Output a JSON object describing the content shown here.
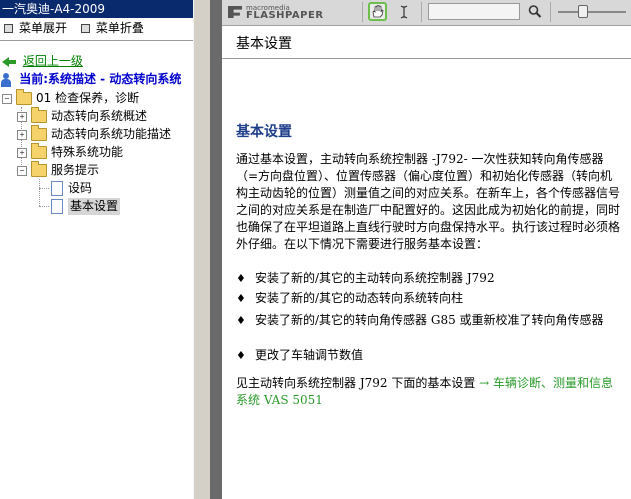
{
  "left_panel": {
    "title": "一汽奥迪-A4-2009",
    "menu_expand": "菜单展开",
    "menu_collapse": "菜单折叠",
    "back_link": "返回上一级",
    "current": "当前:系统描述 - 动态转向系统",
    "tree": [
      {
        "label": "01 检查保养，诊断",
        "expander": "−",
        "icon": "folder-open-icon"
      },
      {
        "label": "动态转向系统概述",
        "expander": "+",
        "icon": "folder-icon"
      },
      {
        "label": "动态转向系统功能描述",
        "expander": "+",
        "icon": "folder-icon"
      },
      {
        "label": "特殊系统功能",
        "expander": "+",
        "icon": "folder-icon"
      },
      {
        "label": "服务提示",
        "expander": "−",
        "icon": "folder-open-icon"
      },
      {
        "label": "设码",
        "icon": "document-icon"
      },
      {
        "label": "基本设置",
        "icon": "document-icon",
        "selected": true
      }
    ]
  },
  "toolbar": {
    "logo_top": "macromedia",
    "logo_bottom": "FLASHPAPER",
    "search_value": "",
    "zoom_level": 0.35
  },
  "document": {
    "header_title": "基本设置",
    "content_title": "基本设置",
    "intro": "通过基本设置，主动转向系统控制器 -J792- 一次性获知转向角传感器（=方向盘位置）、位置传感器（偏心度位置）和初始化传感器（转向机构主动齿轮的位置）测量值之间的对应关系。在新车上，各个传感器信号之间的对应关系是在制造厂中配置好的。这因此成为初始化的前提，同时也确保了在平坦道路上直线行驶时方向盘保持水平。执行该过程时必须格外仔细。在以下情况下需要进行服务基本设置：",
    "bullet_char": "♦",
    "bullets": [
      "安装了新的/其它的主动转向系统控制器 J792",
      "安装了新的/其它的动态转向系统转向柱",
      "安装了新的/其它的转向角传感器 G85 或重新校准了转向角传感器",
      "更改了车轴调节数值"
    ],
    "footer_prefix": "见主动转向系统控制器 J792 下面的基本设置 ",
    "footer_link": "→ 车辆诊断、测量和信息系统 VAS 5051"
  },
  "colors": {
    "title_bar": "#0a2a6e",
    "link_green": "#2a9a2a",
    "current_blue": "#0000cc",
    "heading_blue": "#1f3f8a"
  }
}
